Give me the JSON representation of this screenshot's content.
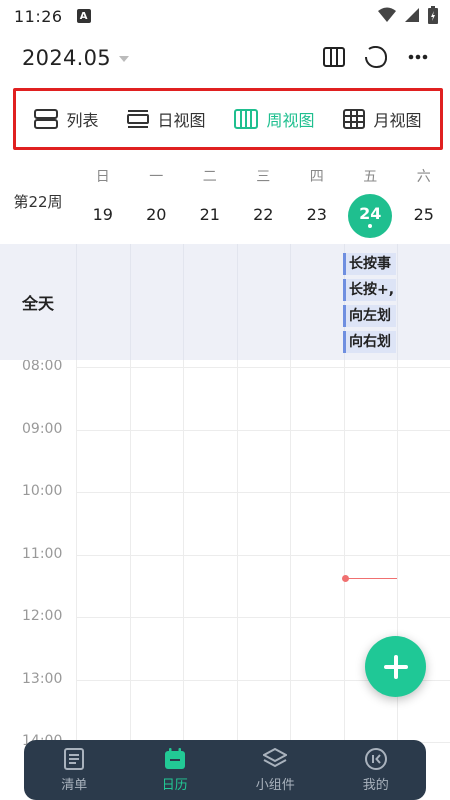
{
  "status": {
    "time": "11:26",
    "a_icon": "A"
  },
  "header": {
    "month": "2024.05"
  },
  "views": [
    {
      "label": "列表",
      "icon": "list-icon"
    },
    {
      "label": "日视图",
      "icon": "day-view-icon"
    },
    {
      "label": "周视图",
      "icon": "week-view-icon",
      "active": true
    },
    {
      "label": "月视图",
      "icon": "month-view-icon"
    }
  ],
  "calendar": {
    "week_label": "第22周",
    "days": [
      {
        "weekday": "日",
        "date": "19"
      },
      {
        "weekday": "一",
        "date": "20"
      },
      {
        "weekday": "二",
        "date": "21"
      },
      {
        "weekday": "三",
        "date": "22"
      },
      {
        "weekday": "四",
        "date": "23"
      },
      {
        "weekday": "五",
        "date": "24",
        "today": true
      },
      {
        "weekday": "六",
        "date": "25"
      }
    ],
    "allday_label": "全天",
    "events": [
      "长按事",
      "长按+,",
      "向左划",
      "向右划"
    ],
    "hours": [
      "08:00",
      "09:00",
      "10:00",
      "11:00",
      "12:00",
      "13:00",
      "14:00"
    ]
  },
  "nav": [
    {
      "label": "清单",
      "icon": "checklist-icon"
    },
    {
      "label": "日历",
      "icon": "calendar-icon",
      "active": true
    },
    {
      "label": "小组件",
      "icon": "widgets-icon"
    },
    {
      "label": "我的",
      "icon": "profile-icon"
    }
  ],
  "colors": {
    "accent": "#1fbf8f",
    "highlight_border": "#e02020",
    "nav_bg": "#2b3a4b"
  }
}
